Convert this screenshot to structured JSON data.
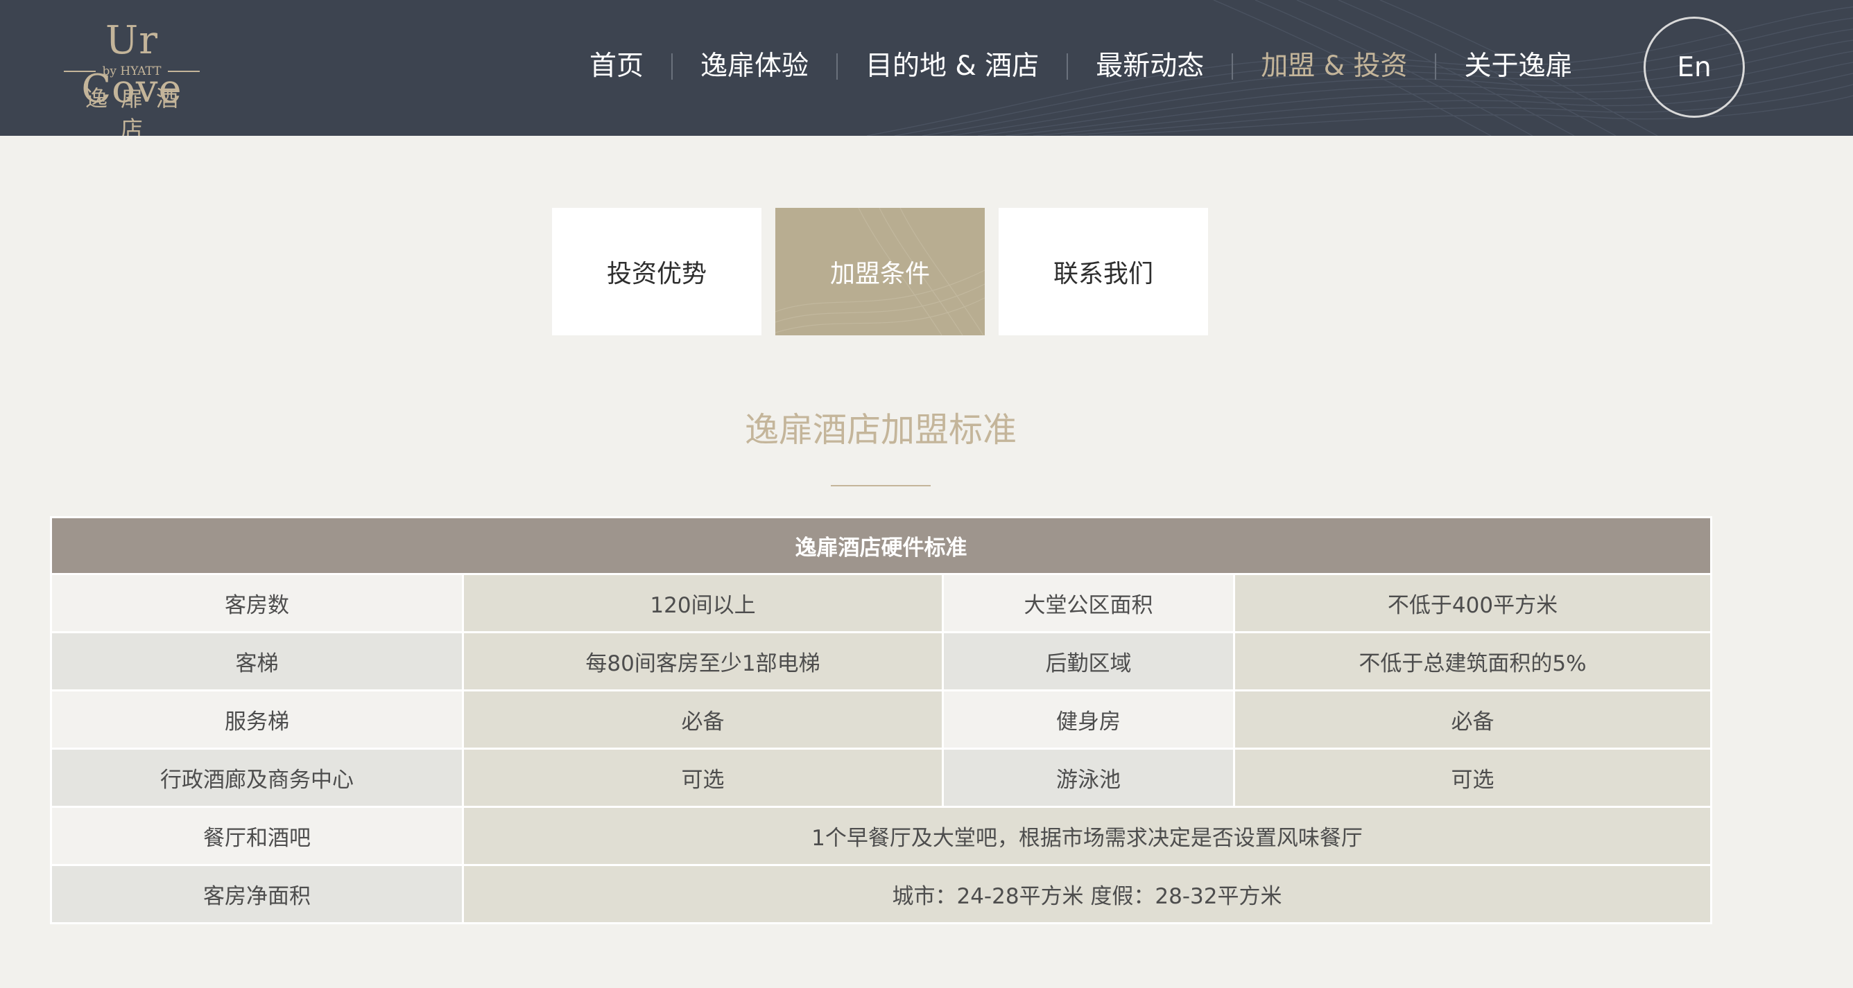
{
  "logo": {
    "brand": "Ur Cove",
    "by": "by HYATT",
    "chinese": "逸扉酒店"
  },
  "nav": {
    "items": [
      {
        "label": "首页",
        "active": false
      },
      {
        "label": "逸扉体验",
        "active": false
      },
      {
        "label": "目的地 & 酒店",
        "active": false
      },
      {
        "label": "最新动态",
        "active": false
      },
      {
        "label": "加盟 & 投资",
        "active": true
      },
      {
        "label": "关于逸扉",
        "active": false
      }
    ],
    "language": "En"
  },
  "tabs": [
    {
      "label": "投资优势",
      "active": false
    },
    {
      "label": "加盟条件",
      "active": true
    },
    {
      "label": "联系我们",
      "active": false
    }
  ],
  "section": {
    "title": "逸扉酒店加盟标准"
  },
  "table": {
    "header": "逸扉酒店硬件标准",
    "rows": [
      {
        "label1": "客房数",
        "value1": "120间以上",
        "label2": "大堂公区面积",
        "value2": "不低于400平方米"
      },
      {
        "label1": "客梯",
        "value1": "每80间客房至少1部电梯",
        "label2": "后勤区域",
        "value2": "不低于总建筑面积的5%"
      },
      {
        "label1": "服务梯",
        "value1": "必备",
        "label2": "健身房",
        "value2": "必备"
      },
      {
        "label1": "行政酒廊及商务中心",
        "value1": "可选",
        "label2": "游泳池",
        "value2": "可选"
      },
      {
        "label1": "餐厅和酒吧",
        "value1": "1个早餐厅及大堂吧，根据市场需求决定是否设置风味餐厅"
      },
      {
        "label1": "客房净面积",
        "value1": "城市：24-28平方米 度假：28-32平方米"
      }
    ]
  },
  "colors": {
    "header_bg": "#3d4450",
    "accent_gold": "#c4b59a",
    "tab_active": "#b8ad91",
    "table_head": "#9e958d",
    "page_bg": "#f2f1ed"
  }
}
